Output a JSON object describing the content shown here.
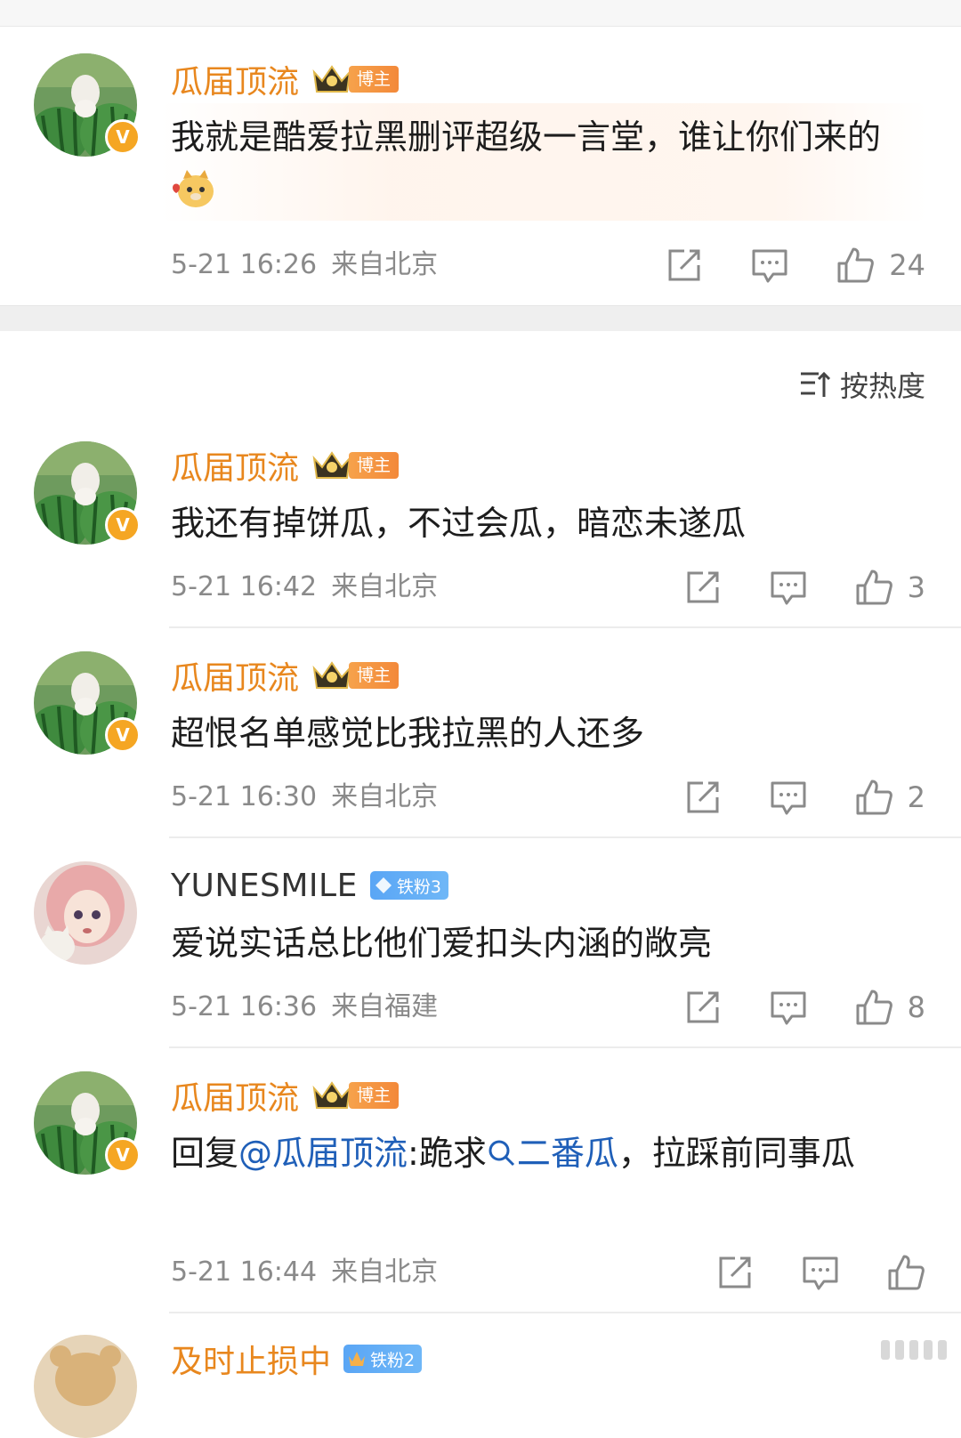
{
  "sort": {
    "label": "按热度",
    "icon": "sort-icon"
  },
  "comments": [
    {
      "user": "瓜届顶流",
      "badge": "博主",
      "text": "我就是酷爱拉黑删评超级一言堂，谁让你们来的",
      "emoji": "doge-emoji",
      "time": "5-21 16:26",
      "location": "来自北京",
      "likes": "24"
    },
    {
      "user": "瓜届顶流",
      "badge": "博主",
      "text": "我还有掉饼瓜，不过会瓜，暗恋未遂瓜",
      "time": "5-21 16:42",
      "location": "来自北京",
      "likes": "3"
    },
    {
      "user": "瓜届顶流",
      "badge": "博主",
      "text": "超恨名单感觉比我拉黑的人还多",
      "time": "5-21 16:30",
      "location": "来自北京",
      "likes": "2"
    },
    {
      "user": "YUNESMILE",
      "badge": "铁粉3",
      "text": "爱说实话总比他们爱扣头内涵的敞亮",
      "time": "5-21 16:36",
      "location": "来自福建",
      "likes": "8"
    },
    {
      "user": "瓜届顶流",
      "badge": "博主",
      "reply_prefix": "回复",
      "mention": "@瓜届顶流",
      "text_a": ":跪求",
      "topic": "二番瓜",
      "text_b": "，拉踩前同事瓜",
      "time": "5-21 16:44",
      "location": "来自北京",
      "likes": ""
    },
    {
      "user": "及时止损中",
      "badge": "铁粉2"
    }
  ]
}
